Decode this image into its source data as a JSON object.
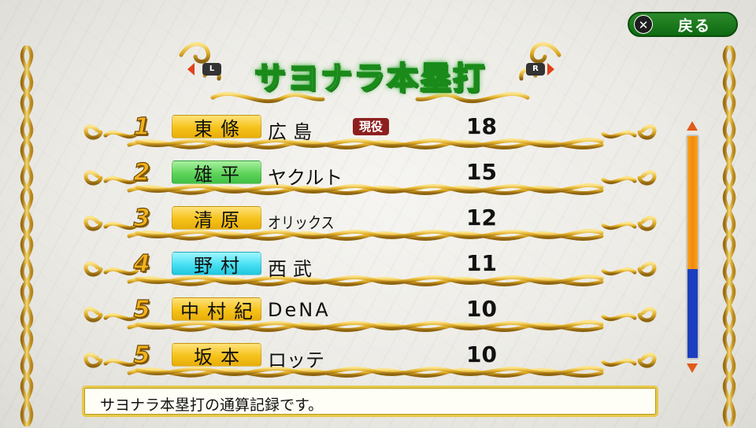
{
  "header": {
    "title": "サヨナラ本塁打",
    "back_label": "戻る",
    "back_icon": "x-button-icon",
    "l_label": "L",
    "r_label": "R"
  },
  "list": {
    "rows": [
      {
        "rank": "1",
        "name": "東條",
        "team": "広島",
        "badge": "現役",
        "count": "18",
        "plate": "yellow"
      },
      {
        "rank": "2",
        "name": "雄平",
        "team": "ヤクルト",
        "badge": "",
        "count": "15",
        "plate": "green"
      },
      {
        "rank": "3",
        "name": "清原",
        "team": "オリックス",
        "badge": "",
        "count": "12",
        "plate": "yellow"
      },
      {
        "rank": "4",
        "name": "野村",
        "team": "西武",
        "badge": "",
        "count": "11",
        "plate": "cyan"
      },
      {
        "rank": "5",
        "name": "中村紀",
        "team": "DeNA",
        "badge": "",
        "count": "10",
        "plate": "yellow"
      },
      {
        "rank": "5",
        "name": "坂本",
        "team": "ロッテ",
        "badge": "",
        "count": "10",
        "plate": "yellow"
      }
    ]
  },
  "scrollbar": {
    "position": 0.0,
    "visible_fraction": 0.6
  },
  "message": {
    "text": "サヨナラ本塁打の通算記録です。"
  },
  "colors": {
    "gold": "#e3b52a",
    "title_green": "#1a8a1a",
    "back_green": "#0f6a12",
    "badge_red": "#8e1f1f",
    "scroll_blue": "#1d3fbf",
    "scroll_orange": "#f2890a"
  }
}
